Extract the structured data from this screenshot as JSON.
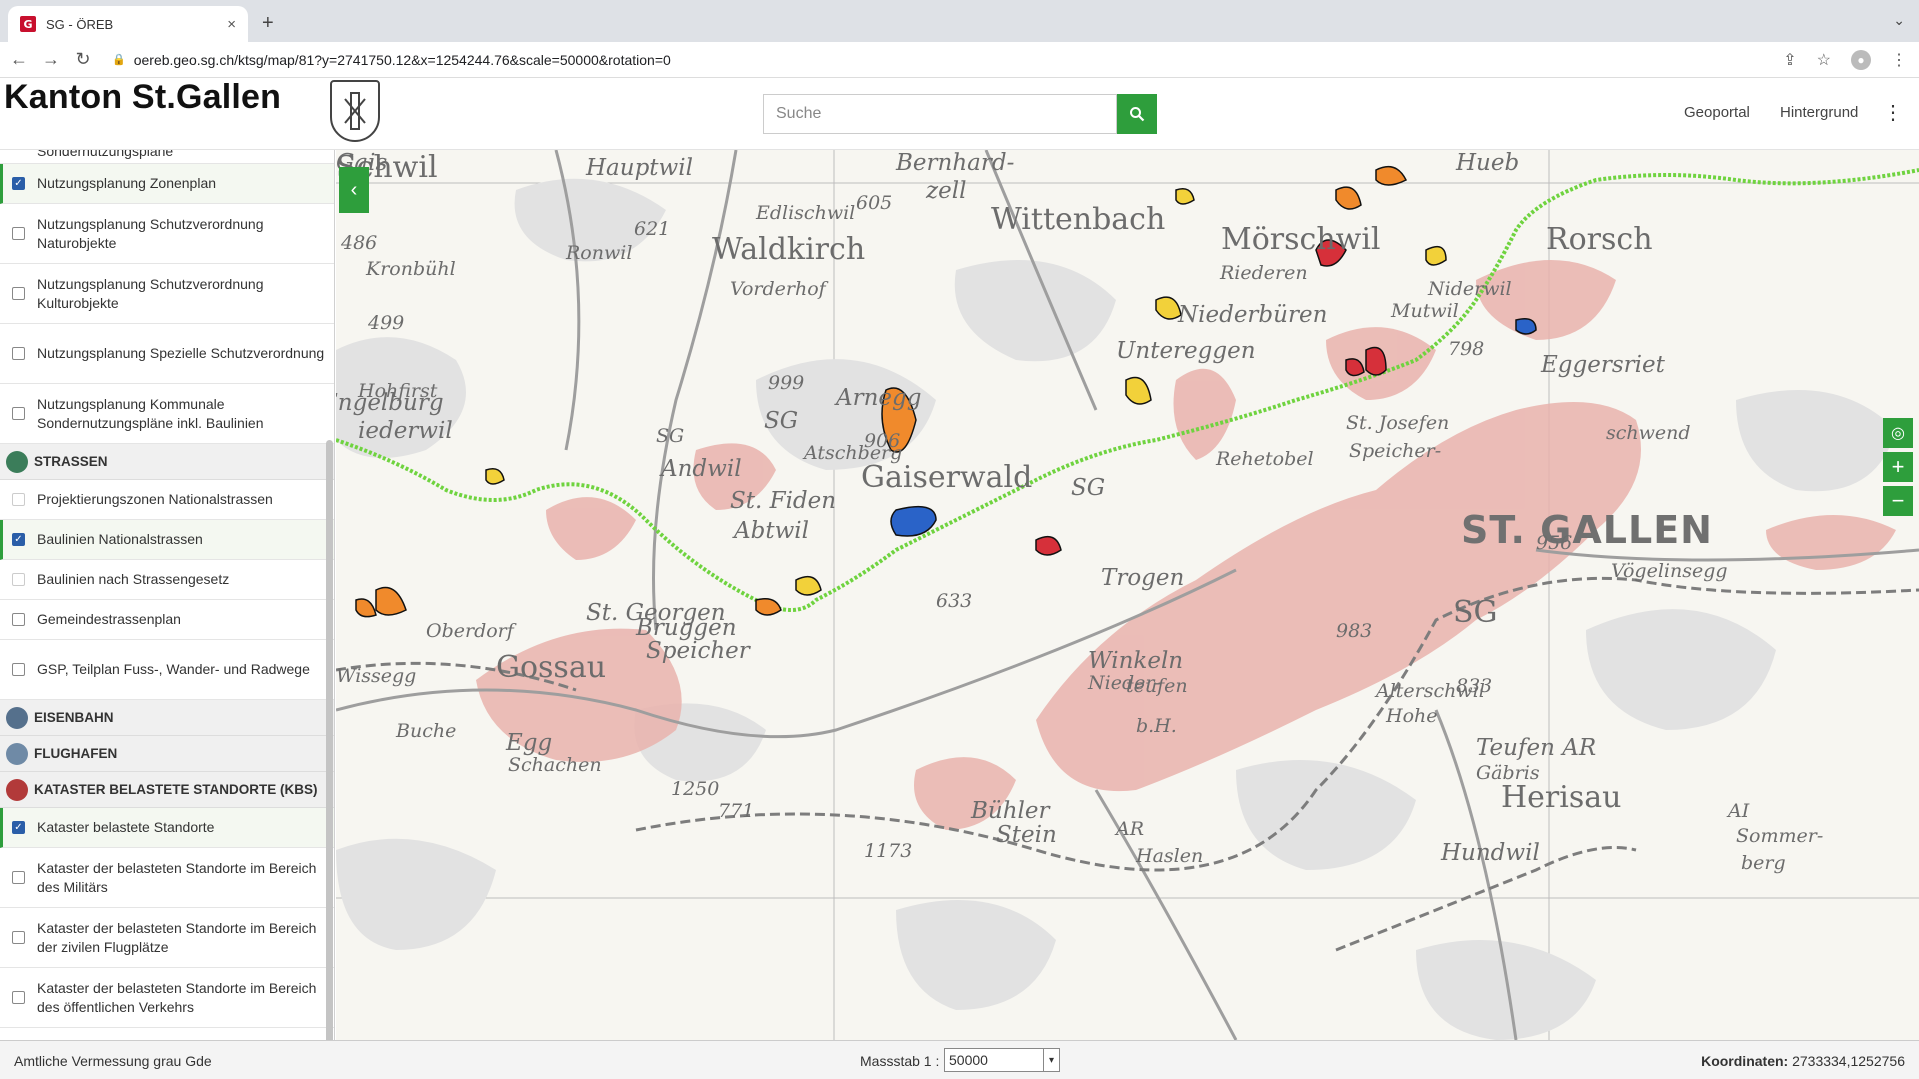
{
  "browser": {
    "tab_title": "SG - ÖREB",
    "favicon_letter": "G",
    "close_glyph": "×",
    "newtab_glyph": "+",
    "url": "oereb.geo.sg.ch/ktsg/map/81?y=2741750.12&x=1254244.76&scale=50000&rotation=0"
  },
  "header": {
    "brand": "Kanton St.Gallen",
    "search_placeholder": "Suche",
    "links": [
      "Geoportal",
      "Hintergrund"
    ]
  },
  "sidebar": {
    "rows": [
      {
        "type": "item",
        "label": "Sondernutzungspläne",
        "state": "partial"
      },
      {
        "type": "item",
        "label": "Nutzungsplanung Zonenplan",
        "state": "checked"
      },
      {
        "type": "item",
        "label": "Nutzungsplanung Schutzverordnung Naturobjekte",
        "state": "unchecked"
      },
      {
        "type": "item",
        "label": "Nutzungsplanung Schutzverordnung Kulturobjekte",
        "state": "unchecked"
      },
      {
        "type": "item",
        "label": "Nutzungsplanung Spezielle Schutzverordnung",
        "state": "unchecked"
      },
      {
        "type": "item",
        "label": "Nutzungsplanung Kommunale Sondernutzungspläne inkl. Baulinien",
        "state": "unchecked"
      },
      {
        "type": "category",
        "label": "STRASSEN",
        "color": "#3b7d5a"
      },
      {
        "type": "item",
        "label": "Projektierungszonen Nationalstrassen",
        "state": "disabled"
      },
      {
        "type": "item",
        "label": "Baulinien Nationalstrassen",
        "state": "checked"
      },
      {
        "type": "item",
        "label": "Baulinien nach Strassengesetz",
        "state": "disabled"
      },
      {
        "type": "item",
        "label": "Gemeindestrassenplan",
        "state": "unchecked"
      },
      {
        "type": "item",
        "label": "GSP, Teilplan Fuss-, Wander- und Radwege",
        "state": "unchecked"
      },
      {
        "type": "category",
        "label": "EISENBAHN",
        "color": "#55708c"
      },
      {
        "type": "category",
        "label": "FLUGHAFEN",
        "color": "#6f8aa6"
      },
      {
        "type": "category",
        "label": "KATASTER BELASTETE STANDORTE (KBS)",
        "color": "#b23a3a"
      },
      {
        "type": "item",
        "label": "Kataster belastete Standorte",
        "state": "checked"
      },
      {
        "type": "item",
        "label": "Kataster der belasteten Standorte im Bereich des Militärs",
        "state": "unchecked"
      },
      {
        "type": "item",
        "label": "Kataster der belasteten Standorte im Bereich der zivilen Flugplätze",
        "state": "unchecked"
      },
      {
        "type": "item",
        "label": "Kataster der belasteten Standorte im Bereich des öffentlichen Verkehrs",
        "state": "unchecked"
      }
    ]
  },
  "map": {
    "labels": [
      {
        "text": "Schwil",
        "size": "med"
      },
      {
        "text": "Hauptwil",
        "size": "sm"
      },
      {
        "text": "Bernhard-",
        "size": "sm"
      },
      {
        "text": "zell",
        "size": "sm"
      },
      {
        "text": "Hueb",
        "size": "sm"
      },
      {
        "text": "Edlischwil",
        "size": "xs"
      },
      {
        "text": "605",
        "size": "xs"
      },
      {
        "text": "Wittenbach",
        "size": "med"
      },
      {
        "text": "Mörschwil",
        "size": "med"
      },
      {
        "text": "Rorsch",
        "size": "med"
      },
      {
        "text": "486",
        "size": "xs"
      },
      {
        "text": "621",
        "size": "xs"
      },
      {
        "text": "Waldkirch",
        "size": "med"
      },
      {
        "text": "Ronwil",
        "size": "xs"
      },
      {
        "text": "Riederen",
        "size": "xs"
      },
      {
        "text": "Vorderhof",
        "size": "xs"
      },
      {
        "text": "Niederbüren",
        "size": "sm"
      },
      {
        "text": "Niderwil",
        "size": "xs"
      },
      {
        "text": "Kronbühl",
        "size": "xs"
      },
      {
        "text": "499",
        "size": "xs"
      },
      {
        "text": "Untereggen",
        "size": "sm"
      },
      {
        "text": "Mutwil",
        "size": "xs"
      },
      {
        "text": "Eggersriet",
        "size": "sm"
      },
      {
        "text": "798",
        "size": "xs"
      },
      {
        "text": "999",
        "size": "xs"
      },
      {
        "text": "Hohfirst",
        "size": "xs"
      },
      {
        "text": "Arnegg",
        "size": "sm"
      },
      {
        "text": "Engelburg",
        "size": "sm"
      },
      {
        "text": "iederwil",
        "size": "sm"
      },
      {
        "text": "SG",
        "size": "xs"
      },
      {
        "text": "Andwil",
        "size": "sm"
      },
      {
        "text": "SG",
        "size": "sm"
      },
      {
        "text": "Atschberg",
        "size": "xs"
      },
      {
        "text": "906",
        "size": "xs"
      },
      {
        "text": "Gaiserwald",
        "size": "med"
      },
      {
        "text": "St. Josefen",
        "size": "xs"
      },
      {
        "text": "Speicher-",
        "size": "xs"
      },
      {
        "text": "schwend",
        "size": "xs"
      },
      {
        "text": "Rehetobel",
        "size": "xs"
      },
      {
        "text": "St. Fiden",
        "size": "sm"
      },
      {
        "text": "Abtwil",
        "size": "sm"
      },
      {
        "text": "SG",
        "size": "sm"
      },
      {
        "text": "ST. GALLEN",
        "size": "big"
      },
      {
        "text": "956",
        "size": "xs"
      },
      {
        "text": "Vögelinsegg",
        "size": "xs"
      },
      {
        "text": "Trogen",
        "size": "sm"
      },
      {
        "text": "St. Georgen",
        "size": "sm"
      },
      {
        "text": "633",
        "size": "xs"
      },
      {
        "text": "Bruggen",
        "size": "sm"
      },
      {
        "text": "Oberdorf",
        "size": "xs"
      },
      {
        "text": "Gossau",
        "size": "med"
      },
      {
        "text": "SG",
        "size": "med"
      },
      {
        "text": "983",
        "size": "xs"
      },
      {
        "text": "Speicher",
        "size": "sm"
      },
      {
        "text": "Winkeln",
        "size": "sm"
      },
      {
        "text": "Nieder-",
        "size": "xs"
      },
      {
        "text": "teufen",
        "size": "xs"
      },
      {
        "text": "833",
        "size": "xs"
      },
      {
        "text": "Wissegg",
        "size": "xs"
      },
      {
        "text": "Alterschwil",
        "size": "xs"
      },
      {
        "text": "Hohe",
        "size": "xs"
      },
      {
        "text": "Buche",
        "size": "xs"
      },
      {
        "text": "Egg",
        "size": "sm"
      },
      {
        "text": "Schachen",
        "size": "xs"
      },
      {
        "text": "b.H.",
        "size": "xs"
      },
      {
        "text": "Teufen AR",
        "size": "sm"
      },
      {
        "text": "Gäbris",
        "size": "xs"
      },
      {
        "text": "1250",
        "size": "xs"
      },
      {
        "text": "771",
        "size": "xs"
      },
      {
        "text": "Herisau",
        "size": "med"
      },
      {
        "text": "Bühler",
        "size": "sm"
      },
      {
        "text": "Stein",
        "size": "sm"
      },
      {
        "text": "AR",
        "size": "xs"
      },
      {
        "text": "Haslen",
        "size": "xs"
      },
      {
        "text": "AI",
        "size": "xs"
      },
      {
        "text": "Sommer-",
        "size": "xs"
      },
      {
        "text": "berg",
        "size": "xs"
      },
      {
        "text": "1173",
        "size": "xs"
      },
      {
        "text": "Hundwil",
        "size": "sm"
      },
      {
        "text": "Gais",
        "size": "sm"
      }
    ]
  },
  "footer": {
    "basemap": "Amtliche Vermessung grau Gde",
    "scale_label": "Massstab 1 :",
    "scale_value": "50000",
    "coords_label": "Koordinaten:",
    "coords_value": "2733334,1252756"
  },
  "icons": {
    "back": "arrow-left-icon",
    "forward": "arrow-right-icon",
    "reload": "reload-icon",
    "search": "magnifier-icon",
    "menu": "kebab-icon",
    "collapse": "chevron-left-icon",
    "locate": "locate-icon",
    "zoom_in": "plus-icon",
    "zoom_out": "minus-icon"
  },
  "colors": {
    "accent": "#2e9e3c",
    "checkbox": "#2a5ea8",
    "settlement": "#e9b3ad",
    "road_baulinie": "#6fd33f",
    "kbs_orange": "#f08a2c",
    "kbs_yellow": "#f2d13a",
    "kbs_blue": "#2a63c8",
    "kbs_red": "#d6303a"
  }
}
